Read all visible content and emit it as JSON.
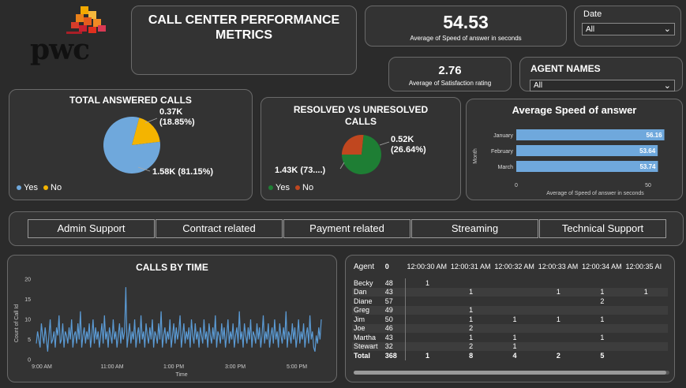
{
  "brand": {
    "logo_text": "pwc"
  },
  "title": {
    "line1": "CALL CENTER PERFORMANCE",
    "line2": "METRICS"
  },
  "kpi_speed": {
    "value": "54.53",
    "label": "Average of Speed of answer in seconds"
  },
  "kpi_satisfaction": {
    "value": "2.76",
    "label": "Average of Satisfaction rating"
  },
  "date_filter": {
    "title": "Date",
    "value": "All"
  },
  "agent_filter": {
    "title": "AGENT NAMES",
    "value": "All"
  },
  "topics": [
    "Admin Support",
    "Contract related",
    "Payment related",
    "Streaming",
    "Technical Support"
  ],
  "colors": {
    "blue": "#6fa8dc",
    "yellow": "#f4b400",
    "green": "#1e7e34",
    "red": "#c0471f",
    "bar": "#6fa8dc",
    "line": "#5b9bd5"
  },
  "chart_data": [
    {
      "type": "pie",
      "title": "TOTAL ANSWERED CALLS",
      "slices": [
        {
          "label": "Yes",
          "value": 1.58,
          "text": "1.58K (81.15%)"
        },
        {
          "label": "No",
          "value": 0.37,
          "text_a": "0.37K",
          "text_b": "(18.85%)"
        }
      ],
      "legend": [
        "Yes",
        "No"
      ],
      "legend_position": "bottom-left"
    },
    {
      "type": "pie",
      "title_a": "RESOLVED VS UNRESOLVED",
      "title_b": "CALLS",
      "slices": [
        {
          "label": "Yes",
          "value": 1.43,
          "text": "1.43K (73....)"
        },
        {
          "label": "No",
          "value": 0.52,
          "text_a": "0.52K",
          "text_b": "(26.64%)"
        }
      ],
      "legend": [
        "Yes",
        "No"
      ],
      "legend_position": "bottom-left"
    },
    {
      "type": "bar",
      "title": "Average Speed of answer",
      "categories": [
        "January",
        "February",
        "March"
      ],
      "values": [
        56.16,
        53.64,
        53.74
      ],
      "labels": [
        "56.16",
        "53.64",
        "53.74"
      ],
      "xlabel": "Average of Speed of answer in seconds",
      "ylabel": "Month",
      "xticks": [
        "0",
        "50"
      ],
      "xlim": [
        0,
        63
      ]
    },
    {
      "type": "line",
      "title": "CALLS BY TIME",
      "xlabel": "Time",
      "ylabel": "Count of Call Id",
      "yticks": [
        "0",
        "5",
        "10",
        "15",
        "20"
      ],
      "xticks": [
        "9:00 AM",
        "11:00 AM",
        "1:00 PM",
        "3:00 PM",
        "5:00 PM"
      ],
      "ylim": [
        0,
        20
      ],
      "x_range": [
        "9:00 AM",
        "5:59 PM"
      ],
      "values": [
        4,
        7,
        5,
        3,
        9,
        6,
        4,
        8,
        5,
        2,
        6,
        10,
        4,
        5,
        7,
        3,
        8,
        6,
        11,
        4,
        5,
        9,
        3,
        7,
        6,
        4,
        8,
        5,
        10,
        3,
        6,
        7,
        4,
        9,
        5,
        12,
        3,
        6,
        8,
        4,
        7,
        5,
        9,
        3,
        6,
        10,
        4,
        8,
        5,
        7,
        3,
        6,
        9,
        4,
        11,
        5,
        7,
        3,
        8,
        6,
        4,
        10,
        5,
        7,
        3,
        6,
        9,
        4,
        8,
        5,
        7,
        18,
        3,
        6,
        9,
        4,
        7,
        5,
        10,
        3,
        6,
        8,
        4,
        11,
        5,
        7,
        3,
        9,
        6,
        4,
        8,
        5,
        10,
        3,
        7,
        6,
        4,
        9,
        5,
        12,
        3,
        6,
        8,
        4,
        7,
        5,
        10,
        3,
        6,
        9,
        4,
        8,
        5,
        7,
        11,
        3,
        6,
        9,
        4,
        7,
        5,
        8,
        3,
        10,
        6,
        4,
        9,
        5,
        7,
        3,
        8,
        6,
        4,
        10,
        5,
        7,
        3,
        9,
        6,
        4,
        8,
        5,
        11,
        3,
        7,
        6,
        4,
        9,
        5,
        8,
        3,
        6,
        10,
        4,
        7,
        5,
        9,
        3,
        6,
        8,
        4,
        12,
        5,
        7,
        3,
        9,
        6,
        4,
        8,
        5,
        10,
        3,
        7,
        6,
        4,
        9,
        5,
        8,
        3,
        6,
        11,
        4,
        7,
        5,
        9,
        3,
        6,
        8,
        4,
        10,
        5,
        7,
        3,
        9,
        6,
        4,
        8,
        5,
        12,
        3,
        7,
        6,
        4,
        9,
        5,
        8,
        3,
        6,
        10,
        4,
        7,
        5,
        9,
        3,
        6,
        8,
        4,
        11,
        5,
        7,
        3,
        2,
        6,
        4,
        8,
        5,
        10
      ]
    },
    {
      "type": "table",
      "columns": [
        "Agent",
        "0",
        "12:00:30 AM",
        "12:00:31 AM",
        "12:00:32 AM",
        "12:00:33 AM",
        "12:00:34 AM",
        "12:00:35 AI"
      ],
      "rows": [
        [
          "Becky",
          "48",
          "1",
          "",
          "",
          "",
          "",
          ""
        ],
        [
          "Dan",
          "43",
          "",
          "1",
          "",
          "1",
          "1",
          "1"
        ],
        [
          "Diane",
          "57",
          "",
          "",
          "",
          "",
          "2",
          ""
        ],
        [
          "Greg",
          "49",
          "",
          "1",
          "",
          "",
          "",
          ""
        ],
        [
          "Jim",
          "50",
          "",
          "1",
          "1",
          "1",
          "1",
          ""
        ],
        [
          "Joe",
          "46",
          "",
          "2",
          "",
          "",
          "",
          ""
        ],
        [
          "Martha",
          "43",
          "",
          "1",
          "1",
          "",
          "1",
          ""
        ],
        [
          "Stewart",
          "32",
          "",
          "2",
          "1",
          "",
          "",
          ""
        ]
      ],
      "total": [
        "Total",
        "368",
        "1",
        "8",
        "4",
        "2",
        "5",
        ""
      ]
    }
  ]
}
